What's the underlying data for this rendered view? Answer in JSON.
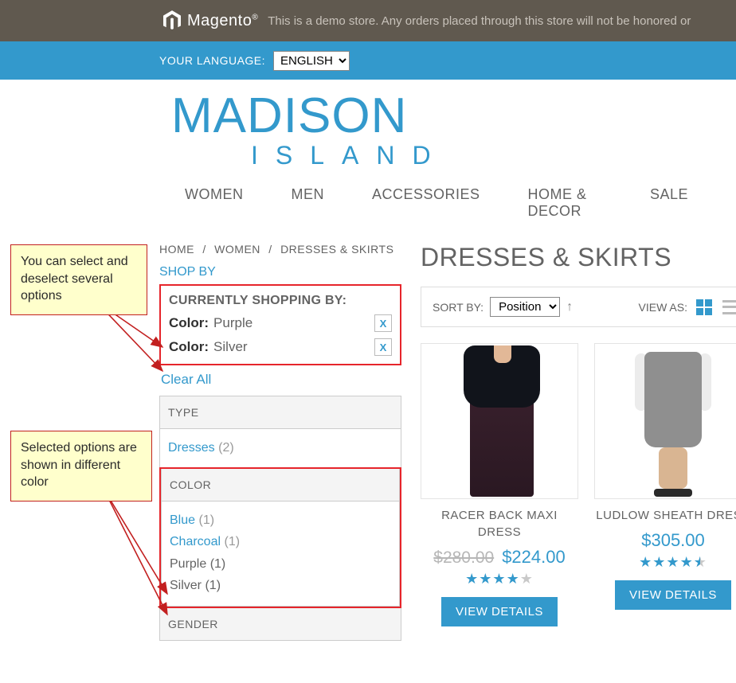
{
  "demo": {
    "text": "This is a demo store. Any orders placed through this store will not be honored or"
  },
  "magento": {
    "label": "Magento"
  },
  "lang": {
    "label": "YOUR LANGUAGE:",
    "value": "ENGLISH"
  },
  "brand": {
    "top": "MADISON",
    "sub": "ISLAND"
  },
  "nav": {
    "women": "WOMEN",
    "men": "MEN",
    "accessories": "ACCESSORIES",
    "home": "HOME & DECOR",
    "sale": "SALE"
  },
  "breadcrumb": {
    "home": "HOME",
    "women": "WOMEN",
    "current": "DRESSES & SKIRTS",
    "sep": "/"
  },
  "shopby": {
    "title": "SHOP BY",
    "currently_head": "CURRENTLY SHOPPING BY:",
    "color_label": "Color:",
    "current": [
      {
        "value": "Purple",
        "x": "X"
      },
      {
        "value": "Silver",
        "x": "X"
      }
    ],
    "clear_all": "Clear All",
    "blocks": {
      "type": {
        "head": "TYPE",
        "items": [
          {
            "label": "Dresses",
            "count": "(2)",
            "selected": false
          }
        ]
      },
      "color": {
        "head": "COLOR",
        "items": [
          {
            "label": "Blue",
            "count": "(1)",
            "selected": false
          },
          {
            "label": "Charcoal",
            "count": "(1)",
            "selected": false
          },
          {
            "label": "Purple",
            "count": "(1)",
            "selected": true
          },
          {
            "label": "Silver",
            "count": "(1)",
            "selected": true
          }
        ]
      },
      "gender": {
        "head": "GENDER"
      }
    }
  },
  "main": {
    "title": "DRESSES & SKIRTS",
    "sortby_label": "SORT BY:",
    "sortby_value": "Position",
    "viewas_label": "VIEW AS:"
  },
  "products": [
    {
      "name": "RACER BACK MAXI DRESS",
      "old_price": "$280.00",
      "price": "$224.00",
      "rating": 4.0,
      "button": "VIEW DETAILS"
    },
    {
      "name": "LUDLOW SHEATH DRESS",
      "old_price": "",
      "price": "$305.00",
      "rating": 4.5,
      "button": "VIEW DETAILS"
    }
  ],
  "annotations": {
    "a1": "You can select and deselect several options",
    "a2": "Selected options are shown in different color"
  }
}
